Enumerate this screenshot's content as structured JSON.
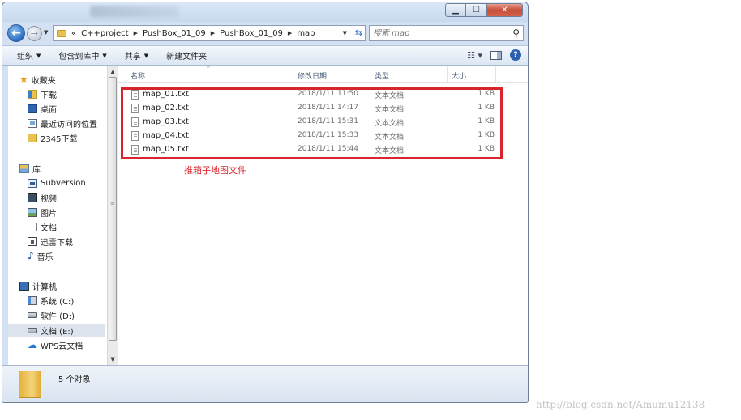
{
  "window": {
    "controls": {
      "minimize": "▁",
      "maximize": "☐",
      "close": "✕"
    }
  },
  "address": {
    "overflow": "«",
    "crumbs": [
      "C++project",
      "PushBox_01_09",
      "PushBox_01_09",
      "map"
    ],
    "refresh_icon": "refresh-icon"
  },
  "search": {
    "placeholder": "搜索 map"
  },
  "toolbar": {
    "organize": "组织",
    "include_in_library": "包含到库中",
    "share": "共享",
    "new_folder": "新建文件夹"
  },
  "sidebar": {
    "favorites": {
      "label": "收藏夹",
      "items": [
        "下载",
        "桌面",
        "最近访问的位置",
        "2345下载"
      ]
    },
    "libraries": {
      "label": "库",
      "items": [
        "Subversion",
        "视频",
        "图片",
        "文档",
        "迅雷下载",
        "音乐"
      ]
    },
    "computer": {
      "label": "计算机",
      "items": [
        "系统 (C:)",
        "软件 (D:)",
        "文档 (E:)",
        "WPS云文档"
      ]
    }
  },
  "columns": {
    "name": "名称",
    "modified": "修改日期",
    "type": "类型",
    "size": "大小"
  },
  "files": [
    {
      "name": "map_01.txt",
      "modified": "2018/1/11 11:50",
      "type": "文本文档",
      "size": "1 KB"
    },
    {
      "name": "map_02.txt",
      "modified": "2018/1/11 14:17",
      "type": "文本文档",
      "size": "1 KB"
    },
    {
      "name": "map_03.txt",
      "modified": "2018/1/11 15:31",
      "type": "文本文档",
      "size": "1 KB"
    },
    {
      "name": "map_04.txt",
      "modified": "2018/1/11 15:33",
      "type": "文本文档",
      "size": "1 KB"
    },
    {
      "name": "map_05.txt",
      "modified": "2018/1/11 15:44",
      "type": "文本文档",
      "size": "1 KB"
    }
  ],
  "annotation": "推箱子地图文件",
  "details": {
    "count": "5 个对象"
  },
  "watermark": "http://blog.csdn.net/Amumu12138",
  "colors": {
    "annotation_red": "#d9242b",
    "window_frame": "#d3e1f2"
  }
}
